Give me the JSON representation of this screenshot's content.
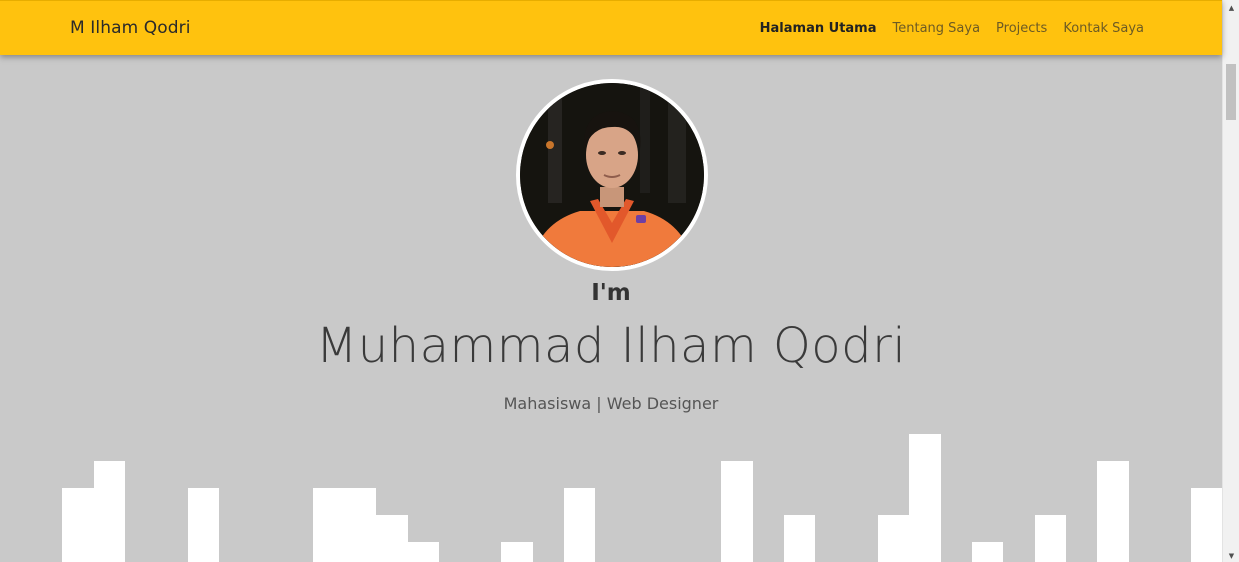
{
  "navbar": {
    "brand": "M Ilham Qodri",
    "links": [
      {
        "label": "Halaman Utama",
        "active": true
      },
      {
        "label": "Tentang Saya",
        "active": false
      },
      {
        "label": "Projects",
        "active": false
      },
      {
        "label": "Kontak Saya",
        "active": false
      }
    ]
  },
  "hero": {
    "intro": "I'm",
    "name": "Muhammad Ilham Qodri",
    "subtitle": "Mahasiswa | Web Designer"
  },
  "colors": {
    "navbar_bg": "#ffc20e",
    "page_bg": "#c9c9c9",
    "skyline": "#ffffff"
  },
  "icons": {
    "avatar": "profile-photo"
  }
}
